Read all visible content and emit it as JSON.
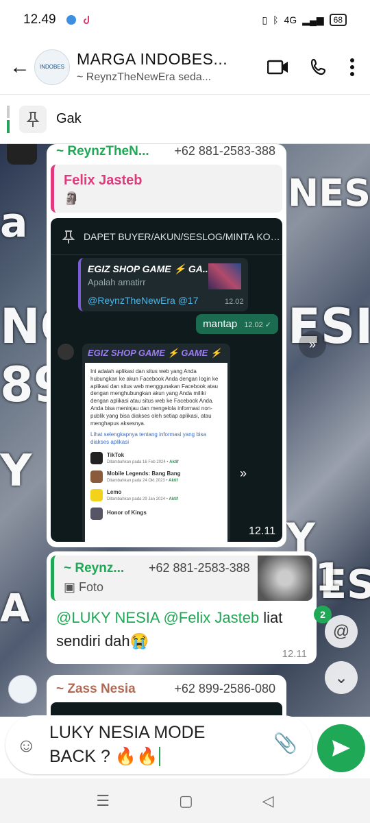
{
  "status": {
    "time": "12.49",
    "battery": "68",
    "signal": "4G"
  },
  "header": {
    "title": "MARGA INDOBES...",
    "subtitle": "~ ReynzTheNewEra seda...",
    "avatar_text": "INDOBES"
  },
  "pinned": {
    "text": "Gak"
  },
  "watermark": {
    "w1": "NESIA",
    "w2": "ESIA",
    "w3": "NO",
    "w4": "89",
    "w5": "a",
    "w6": "Y N",
    "w7": "Y NES",
    "w8": "A",
    "w9": "1"
  },
  "msg1": {
    "sender": "~ ReynzTheN...",
    "phone": "+62 881-2583-388",
    "quote_name": "Felix Jasteb",
    "quote_emoji": "🗿",
    "time": "12.11",
    "shot": {
      "pinned": "DAPET BUYER/AKUN/SESLOG/MINTA KODE...",
      "quote_title": "EGIZ SHOP GAME ⚡ GA...",
      "quote_sub": "Apalah amatirr",
      "mention": "@ReynzTheNewEra @17",
      "quote_time": "12.02",
      "mantap": "mantap",
      "mantap_time": "12.02 ✓",
      "egiz_title": "EGIZ SHOP GAME ⚡ GAME ⚡",
      "card_text": "Ini adalah aplikasi dan situs web yang Anda hubungkan ke akun Facebook Anda dengan login ke aplikasi dan situs web menggunakan Facebook atau dengan menghubungkan akun yang Anda miliki dengan aplikasi atau situs web ke Facebook Anda. Anda bisa meninjau dan mengelola informasi non-publik yang bisa diakses oleh setiap aplikasi, atau menghapus aksesnya.",
      "card_link": "Lihat selengkapnya tentang informasi yang bisa diakses aplikasi",
      "apps": [
        {
          "name": "TikTok",
          "date": "Ditambahkan pada 16 Feb 2024 •",
          "status": "Aktif"
        },
        {
          "name": "Mobile Legends: Bang Bang",
          "date": "Ditambahkan pada 24 Okt 2023 •",
          "status": "Aktif"
        },
        {
          "name": "Lemo",
          "date": "Ditambahkan pada 29 Jan 2024 •",
          "status": "Aktif"
        },
        {
          "name": "Honor of Kings",
          "date": "",
          "status": ""
        }
      ]
    }
  },
  "msg2": {
    "sender": "~ Reynz...",
    "phone": "+62 881-2583-388",
    "quote_type": "Foto",
    "mention1": "@LUKY NESIA",
    "mention2": "@Felix Jasteb",
    "text1": " liat",
    "text2": "sendiri dah😭",
    "time": "12.11"
  },
  "msg3": {
    "sender": "~ Zass Nesia",
    "phone": "+62 899-2586-080"
  },
  "mentions_badge": "2",
  "input": {
    "text1": "LUKY NESIA MODE",
    "text2": "BACK ? 🔥🔥"
  }
}
